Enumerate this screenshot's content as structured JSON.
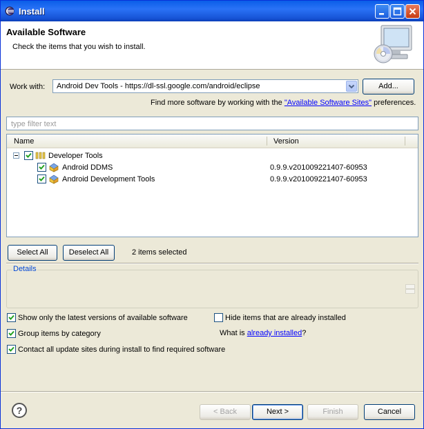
{
  "window": {
    "title": "Install"
  },
  "header": {
    "title": "Available Software",
    "description": "Check the items that you wish to install."
  },
  "work_with": {
    "label": "Work with:",
    "value": "Android Dev Tools - https://dl-ssl.google.com/android/eclipse",
    "add_button": "Add...",
    "find_more_prefix": "Find more software by working with the ",
    "find_more_link": "\"Available Software Sites\"",
    "find_more_suffix": " preferences."
  },
  "filter": {
    "placeholder": "type filter text"
  },
  "table": {
    "columns": [
      "Name",
      "Version"
    ],
    "group": {
      "label": "Developer Tools",
      "checked": true,
      "expanded": true
    },
    "rows": [
      {
        "name": "Android DDMS",
        "version": "0.9.9.v201009221407-60953",
        "checked": true
      },
      {
        "name": "Android Development Tools",
        "version": "0.9.9.v201009221407-60953",
        "checked": true
      }
    ]
  },
  "selection": {
    "select_all": "Select All",
    "deselect_all": "Deselect All",
    "status": "2 items selected"
  },
  "details": {
    "label": "Details"
  },
  "options": {
    "latest_versions": {
      "label": "Show only the latest versions of available software",
      "checked": true
    },
    "hide_installed": {
      "label": "Hide items that are already installed",
      "checked": false
    },
    "group_by_category": {
      "label": "Group items by category",
      "checked": true
    },
    "what_is_prefix": "What is ",
    "what_is_link": "already installed",
    "what_is_suffix": "?",
    "contact_sites": {
      "label": "Contact all update sites during install to find required software",
      "checked": true
    }
  },
  "footer": {
    "back": "< Back",
    "next": "Next >",
    "finish": "Finish",
    "cancel": "Cancel"
  },
  "colors": {
    "titlebar": "#0a5ee8",
    "link": "#0000ff",
    "details_label": "#0046d5",
    "window_bg": "#ece9d8"
  }
}
